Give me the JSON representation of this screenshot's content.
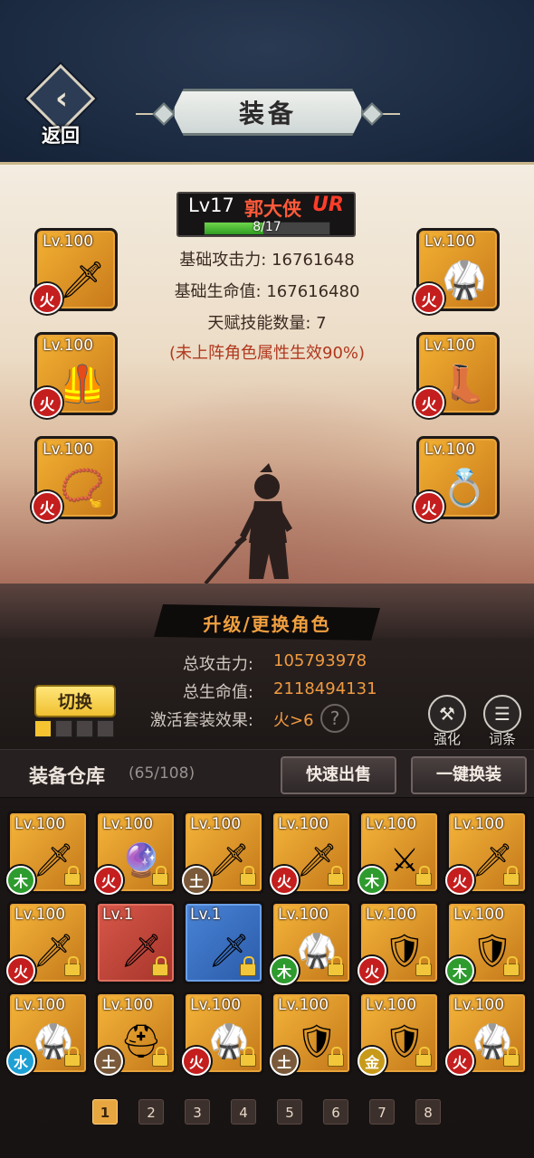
{
  "header": {
    "title": "装备",
    "back_label": "返回"
  },
  "hero": {
    "level": "Lv17",
    "name": "郭大侠",
    "rarity": "UR",
    "xp_text": "8/17",
    "xp_fraction": 0.47,
    "stats": [
      "基础攻击力: 16761648",
      "基础生命值: 167616480",
      "天赋技能数量: 7"
    ],
    "note": "(未上阵角色属性生效90%)"
  },
  "equipped": {
    "left": [
      {
        "level": "Lv.100",
        "element": "火",
        "icon": "golden-sword-icon",
        "art": "🗡"
      },
      {
        "level": "Lv.100",
        "element": "火",
        "icon": "golden-armor-icon",
        "art": "🦺"
      },
      {
        "level": "Lv.100",
        "element": "火",
        "icon": "amulet-icon",
        "art": "📿"
      }
    ],
    "right": [
      {
        "level": "Lv.100",
        "element": "火",
        "icon": "red-armor-icon",
        "art": "🥋"
      },
      {
        "level": "Lv.100",
        "element": "火",
        "icon": "red-boots-icon",
        "art": "👢"
      },
      {
        "level": "Lv.100",
        "element": "火",
        "icon": "golden-ring-icon",
        "art": "💍"
      }
    ]
  },
  "upgrade": {
    "label": "升级/更换角色"
  },
  "totals": [
    {
      "label": "总攻击力:",
      "value": "105793978"
    },
    {
      "label": "总生命值:",
      "value": "2118494131"
    },
    {
      "label": "激活套装效果:",
      "value": "火>6"
    }
  ],
  "help_glyph": "?",
  "switch": {
    "label": "切换",
    "presets": [
      "#f5c430",
      "#4a4444",
      "#4a4444",
      "#4a4444"
    ]
  },
  "side_buttons": [
    {
      "label": "强化",
      "icon": "hammer-icon",
      "glyph": "⚒"
    },
    {
      "label": "词条",
      "icon": "list-icon",
      "glyph": "☰"
    }
  ],
  "storage": {
    "title": "装备仓库",
    "count": "(65/108)",
    "quick_sell": "快速出售",
    "one_key_swap": "一键换装"
  },
  "inventory": [
    {
      "level": "Lv.100",
      "element": "木",
      "rarity": "orange",
      "icon": "golden-sword-icon",
      "art": "🗡"
    },
    {
      "level": "Lv.100",
      "element": "火",
      "rarity": "orange",
      "icon": "purple-staff-icon",
      "art": "🔮"
    },
    {
      "level": "Lv.100",
      "element": "土",
      "rarity": "orange",
      "icon": "golden-sword-icon",
      "art": "🗡"
    },
    {
      "level": "Lv.100",
      "element": "火",
      "rarity": "orange",
      "icon": "red-blade-icon",
      "art": "🗡"
    },
    {
      "level": "Lv.100",
      "element": "木",
      "rarity": "orange",
      "icon": "ice-sword-icon",
      "art": "⚔"
    },
    {
      "level": "Lv.100",
      "element": "火",
      "rarity": "orange",
      "icon": "golden-sword-icon",
      "art": "🗡"
    },
    {
      "level": "Lv.100",
      "element": "火",
      "rarity": "orange",
      "icon": "golden-sword-icon",
      "art": "🗡"
    },
    {
      "level": "Lv.1",
      "element": "",
      "rarity": "red",
      "icon": "steel-sword-icon",
      "art": "🗡"
    },
    {
      "level": "Lv.1",
      "element": "",
      "rarity": "blue",
      "icon": "green-sword-icon",
      "art": "🗡"
    },
    {
      "level": "Lv.100",
      "element": "木",
      "rarity": "orange",
      "icon": "red-armor-icon",
      "art": "🥋"
    },
    {
      "level": "Lv.100",
      "element": "火",
      "rarity": "orange",
      "icon": "blue-armor-icon",
      "art": "🛡"
    },
    {
      "level": "Lv.100",
      "element": "木",
      "rarity": "orange",
      "icon": "blue-armor-icon",
      "art": "🛡"
    },
    {
      "level": "Lv.100",
      "element": "水",
      "rarity": "orange",
      "icon": "red-armor-icon",
      "art": "🥋"
    },
    {
      "level": "Lv.100",
      "element": "土",
      "rarity": "orange",
      "icon": "golden-helmet-icon",
      "art": "⛑"
    },
    {
      "level": "Lv.100",
      "element": "火",
      "rarity": "orange",
      "icon": "red-armor-icon",
      "art": "🥋"
    },
    {
      "level": "Lv.100",
      "element": "土",
      "rarity": "orange",
      "icon": "blue-armor-icon",
      "art": "🛡"
    },
    {
      "level": "Lv.100",
      "element": "金",
      "rarity": "orange",
      "icon": "dark-armor-icon",
      "art": "🛡"
    },
    {
      "level": "Lv.100",
      "element": "火",
      "rarity": "orange",
      "icon": "red-armor-icon",
      "art": "🥋"
    }
  ],
  "pagination": {
    "pages": [
      "1",
      "2",
      "3",
      "4",
      "5",
      "6",
      "7",
      "8"
    ],
    "current": "1"
  },
  "colors": {
    "fire": "#c41e1e",
    "wood": "#2e9b2e",
    "earth": "#7a5a3a",
    "water": "#1ea0d4",
    "metal": "#c79a1a",
    "accent": "#f09a40"
  }
}
